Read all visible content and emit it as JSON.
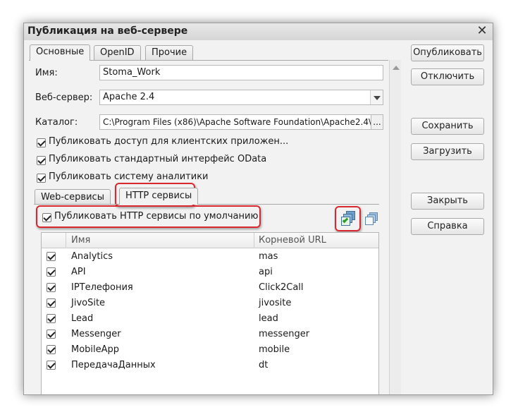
{
  "window": {
    "title": "Публикация на веб-сервере",
    "close": "✕"
  },
  "tabs": [
    "Основные",
    "OpenID",
    "Прочие"
  ],
  "form": {
    "name_label": "Имя:",
    "name_value": "Stoma_Work",
    "server_label": "Веб-сервер:",
    "server_value": "Apache 2.4",
    "catalog_label": "Каталог:",
    "catalog_value": "C:\\Program Files (x86)\\Apache Software Foundation\\Apache2.4\\",
    "catalog_btn": "..."
  },
  "checks": [
    {
      "label": "Публиковать доступ для клиентских приложен...",
      "checked": true
    },
    {
      "label": "Публиковать стандартный интерфейс OData",
      "checked": true
    },
    {
      "label": "Публиковать систему аналитики",
      "checked": true
    }
  ],
  "subtabs": [
    "Web-сервисы",
    "HTTP сервисы"
  ],
  "http_default": {
    "label": "Публиковать HTTP сервисы по умолчанию",
    "checked": true
  },
  "table": {
    "columns": [
      "Имя",
      "Корневой URL"
    ],
    "rows": [
      {
        "name": "Analytics",
        "url": "mas"
      },
      {
        "name": "API",
        "url": "api"
      },
      {
        "name": "IPТелефония",
        "url": "Click2Call"
      },
      {
        "name": "JivoSite",
        "url": "jivosite"
      },
      {
        "name": "Lead",
        "url": "lead"
      },
      {
        "name": "Messenger",
        "url": "messenger"
      },
      {
        "name": "MobileApp",
        "url": "mobile"
      },
      {
        "name": "ПередачаДанных",
        "url": "dt"
      }
    ]
  },
  "buttons": {
    "publish": "Опубликовать",
    "disable": "Отключить",
    "save": "Сохранить",
    "load": "Загрузить",
    "close": "Закрыть",
    "help": "Справка"
  },
  "colors": {
    "highlight": "#d9282f",
    "window_bg": "#f2f2f2"
  }
}
